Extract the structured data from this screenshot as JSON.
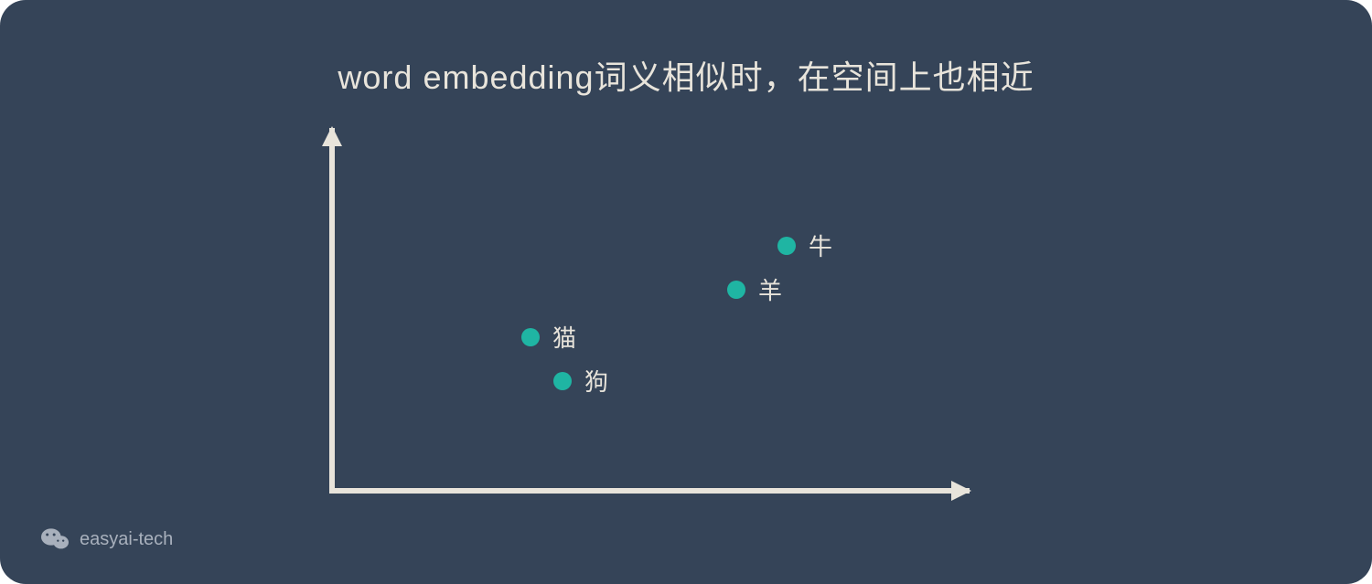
{
  "title": "word embedding词义相似时，在空间上也相近",
  "watermark": "easyai-tech",
  "chart_data": {
    "type": "scatter",
    "title": "word embedding词义相似时，在空间上也相近",
    "xlabel": "",
    "ylabel": "",
    "xlim": [
      0,
      10
    ],
    "ylim": [
      0,
      10
    ],
    "points": [
      {
        "label": "猫",
        "x": 3.0,
        "y": 4.5
      },
      {
        "label": "狗",
        "x": 3.5,
        "y": 3.3
      },
      {
        "label": "羊",
        "x": 6.2,
        "y": 5.8
      },
      {
        "label": "牛",
        "x": 7.0,
        "y": 7.0
      }
    ],
    "point_color": "#1fb5a3",
    "axis_color": "#e8e4db"
  }
}
